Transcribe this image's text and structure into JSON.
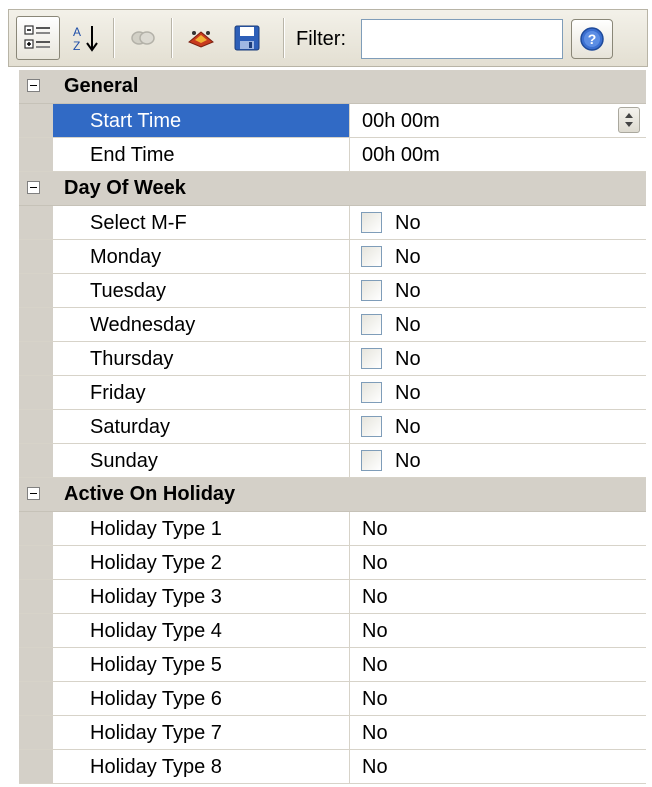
{
  "toolbar": {
    "buttons": [
      {
        "name": "categorized-view-button",
        "icon": "categorized-icon",
        "active": true
      },
      {
        "name": "alphabetical-sort-button",
        "icon": "sort-az-icon",
        "active": false
      },
      {
        "name": "property-pages-button",
        "icon": "property-pages-icon",
        "active": false,
        "disabled": true
      },
      {
        "name": "clear-button",
        "icon": "eraser-icon",
        "active": false
      },
      {
        "name": "save-button",
        "icon": "floppy-disk-icon",
        "active": false
      }
    ],
    "filter_label": "Filter:",
    "filter_value": "",
    "help_icon": "help-icon"
  },
  "categories": [
    {
      "label": "General",
      "properties": [
        {
          "name": "Start Time",
          "value": "00h 00m",
          "type": "spinner",
          "selected": true
        },
        {
          "name": "End Time",
          "value": "00h 00m",
          "type": "text",
          "selected": false
        }
      ]
    },
    {
      "label": "Day Of Week",
      "properties": [
        {
          "name": "Select M-F",
          "value": "No",
          "type": "checkbox"
        },
        {
          "name": "Monday",
          "value": "No",
          "type": "checkbox"
        },
        {
          "name": "Tuesday",
          "value": "No",
          "type": "checkbox"
        },
        {
          "name": "Wednesday",
          "value": "No",
          "type": "checkbox"
        },
        {
          "name": "Thursday",
          "value": "No",
          "type": "checkbox"
        },
        {
          "name": "Friday",
          "value": "No",
          "type": "checkbox"
        },
        {
          "name": "Saturday",
          "value": "No",
          "type": "checkbox"
        },
        {
          "name": "Sunday",
          "value": "No",
          "type": "checkbox"
        }
      ]
    },
    {
      "label": "Active On Holiday",
      "properties": [
        {
          "name": "Holiday Type 1",
          "value": "No",
          "type": "text"
        },
        {
          "name": "Holiday Type 2",
          "value": "No",
          "type": "text"
        },
        {
          "name": "Holiday Type 3",
          "value": "No",
          "type": "text"
        },
        {
          "name": "Holiday Type 4",
          "value": "No",
          "type": "text"
        },
        {
          "name": "Holiday Type 5",
          "value": "No",
          "type": "text"
        },
        {
          "name": "Holiday Type 6",
          "value": "No",
          "type": "text"
        },
        {
          "name": "Holiday Type 7",
          "value": "No",
          "type": "text"
        },
        {
          "name": "Holiday Type 8",
          "value": "No",
          "type": "text"
        }
      ]
    }
  ],
  "colors": {
    "selection": "#316ac5",
    "category_bg": "#d4d0c8",
    "grid_line": "#d7d3c9"
  }
}
